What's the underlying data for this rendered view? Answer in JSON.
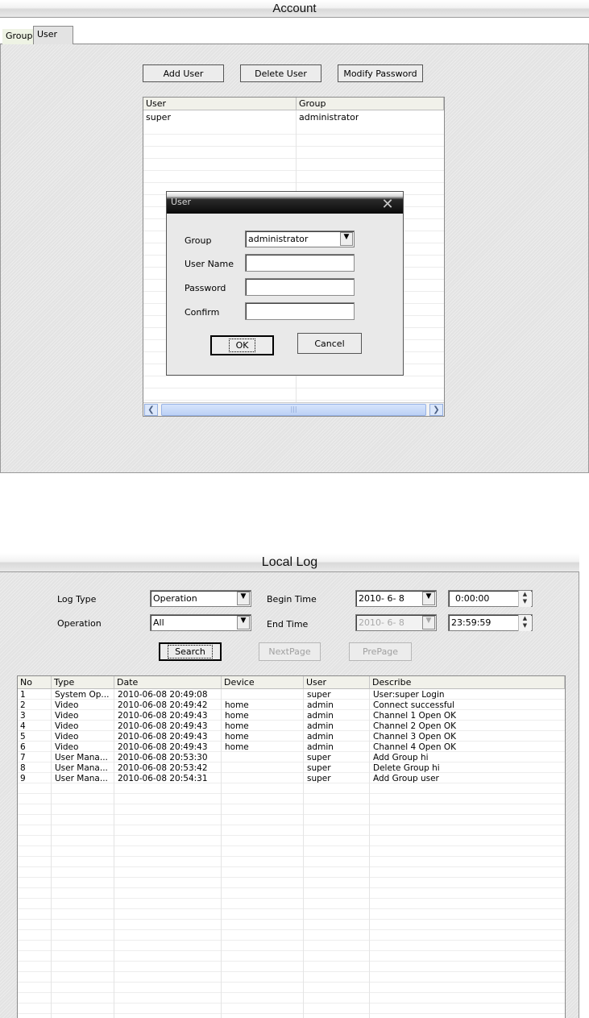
{
  "account": {
    "title": "Account",
    "tabs": [
      "Group",
      "User"
    ],
    "buttons": {
      "add_user": "Add User",
      "delete_user": "Delete User",
      "modify_password": "Modify Password"
    },
    "table": {
      "columns": [
        "User",
        "Group"
      ],
      "rows": [
        {
          "user": "super",
          "group": "administrator"
        }
      ]
    },
    "dialog": {
      "title": "User",
      "group_label": "Group",
      "group_value": "administrator",
      "username_label": "User Name",
      "username_value": "",
      "password_label": "Password",
      "password_value": "",
      "confirm_label": "Confirm",
      "confirm_value": "",
      "ok_label": "OK",
      "cancel_label": "Cancel"
    }
  },
  "local_log": {
    "title": "Local Log",
    "filters": {
      "log_type_label": "Log Type",
      "log_type_value": "Operation",
      "operation_label": "Operation",
      "operation_value": "All",
      "begin_time_label": "Begin Time",
      "begin_date": "2010- 6- 8",
      "begin_time": "0:00:00",
      "end_time_label": "End Time",
      "end_date": "2010- 6- 8",
      "end_time": "23:59:59"
    },
    "buttons": {
      "search": "Search",
      "next_page": "NextPage",
      "pre_page": "PrePage"
    },
    "columns": [
      "No",
      "Type",
      "Date",
      "Device",
      "User",
      "Describe"
    ],
    "rows": [
      {
        "no": "1",
        "type": "System Op...",
        "date": "2010-06-08 20:49:08",
        "device": "",
        "user": "super",
        "describe": "User:super  Login"
      },
      {
        "no": "2",
        "type": "Video",
        "date": "2010-06-08 20:49:42",
        "device": "home",
        "user": "admin",
        "describe": "Connect successful"
      },
      {
        "no": "3",
        "type": "Video",
        "date": "2010-06-08 20:49:43",
        "device": "home",
        "user": "admin",
        "describe": "Channel 1 Open OK"
      },
      {
        "no": "4",
        "type": "Video",
        "date": "2010-06-08 20:49:43",
        "device": "home",
        "user": "admin",
        "describe": "Channel 2 Open OK"
      },
      {
        "no": "5",
        "type": "Video",
        "date": "2010-06-08 20:49:43",
        "device": "home",
        "user": "admin",
        "describe": "Channel 3 Open OK"
      },
      {
        "no": "6",
        "type": "Video",
        "date": "2010-06-08 20:49:43",
        "device": "home",
        "user": "admin",
        "describe": "Channel 4 Open OK"
      },
      {
        "no": "7",
        "type": "User Mana...",
        "date": "2010-06-08 20:53:30",
        "device": "",
        "user": "super",
        "describe": "Add Group hi"
      },
      {
        "no": "8",
        "type": "User Mana...",
        "date": "2010-06-08 20:53:42",
        "device": "",
        "user": "super",
        "describe": "Delete Group hi"
      },
      {
        "no": "9",
        "type": "User Mana...",
        "date": "2010-06-08 20:54:31",
        "device": "",
        "user": "super",
        "describe": "Add Group user"
      }
    ]
  },
  "icons": {
    "dropdown": "▼",
    "close": "✕",
    "scroll_left": "❮",
    "scroll_right": "❯",
    "spin_up": "▲",
    "spin_down": "▼",
    "grip": "|||"
  }
}
